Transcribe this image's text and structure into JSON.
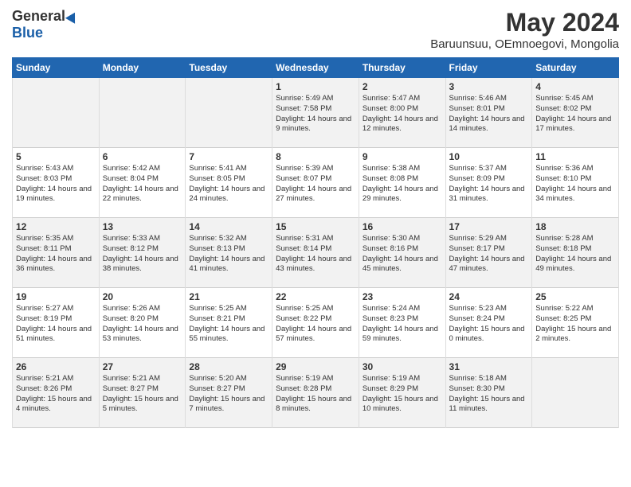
{
  "logo": {
    "general": "General",
    "blue": "Blue"
  },
  "title": "May 2024",
  "location": "Baruunsuu, OEmnoegovi, Mongolia",
  "days_of_week": [
    "Sunday",
    "Monday",
    "Tuesday",
    "Wednesday",
    "Thursday",
    "Friday",
    "Saturday"
  ],
  "weeks": [
    [
      {
        "day": "",
        "content": ""
      },
      {
        "day": "",
        "content": ""
      },
      {
        "day": "",
        "content": ""
      },
      {
        "day": "1",
        "content": "Sunrise: 5:49 AM\nSunset: 7:58 PM\nDaylight: 14 hours\nand 9 minutes."
      },
      {
        "day": "2",
        "content": "Sunrise: 5:47 AM\nSunset: 8:00 PM\nDaylight: 14 hours\nand 12 minutes."
      },
      {
        "day": "3",
        "content": "Sunrise: 5:46 AM\nSunset: 8:01 PM\nDaylight: 14 hours\nand 14 minutes."
      },
      {
        "day": "4",
        "content": "Sunrise: 5:45 AM\nSunset: 8:02 PM\nDaylight: 14 hours\nand 17 minutes."
      }
    ],
    [
      {
        "day": "5",
        "content": "Sunrise: 5:43 AM\nSunset: 8:03 PM\nDaylight: 14 hours\nand 19 minutes."
      },
      {
        "day": "6",
        "content": "Sunrise: 5:42 AM\nSunset: 8:04 PM\nDaylight: 14 hours\nand 22 minutes."
      },
      {
        "day": "7",
        "content": "Sunrise: 5:41 AM\nSunset: 8:05 PM\nDaylight: 14 hours\nand 24 minutes."
      },
      {
        "day": "8",
        "content": "Sunrise: 5:39 AM\nSunset: 8:07 PM\nDaylight: 14 hours\nand 27 minutes."
      },
      {
        "day": "9",
        "content": "Sunrise: 5:38 AM\nSunset: 8:08 PM\nDaylight: 14 hours\nand 29 minutes."
      },
      {
        "day": "10",
        "content": "Sunrise: 5:37 AM\nSunset: 8:09 PM\nDaylight: 14 hours\nand 31 minutes."
      },
      {
        "day": "11",
        "content": "Sunrise: 5:36 AM\nSunset: 8:10 PM\nDaylight: 14 hours\nand 34 minutes."
      }
    ],
    [
      {
        "day": "12",
        "content": "Sunrise: 5:35 AM\nSunset: 8:11 PM\nDaylight: 14 hours\nand 36 minutes."
      },
      {
        "day": "13",
        "content": "Sunrise: 5:33 AM\nSunset: 8:12 PM\nDaylight: 14 hours\nand 38 minutes."
      },
      {
        "day": "14",
        "content": "Sunrise: 5:32 AM\nSunset: 8:13 PM\nDaylight: 14 hours\nand 41 minutes."
      },
      {
        "day": "15",
        "content": "Sunrise: 5:31 AM\nSunset: 8:14 PM\nDaylight: 14 hours\nand 43 minutes."
      },
      {
        "day": "16",
        "content": "Sunrise: 5:30 AM\nSunset: 8:16 PM\nDaylight: 14 hours\nand 45 minutes."
      },
      {
        "day": "17",
        "content": "Sunrise: 5:29 AM\nSunset: 8:17 PM\nDaylight: 14 hours\nand 47 minutes."
      },
      {
        "day": "18",
        "content": "Sunrise: 5:28 AM\nSunset: 8:18 PM\nDaylight: 14 hours\nand 49 minutes."
      }
    ],
    [
      {
        "day": "19",
        "content": "Sunrise: 5:27 AM\nSunset: 8:19 PM\nDaylight: 14 hours\nand 51 minutes."
      },
      {
        "day": "20",
        "content": "Sunrise: 5:26 AM\nSunset: 8:20 PM\nDaylight: 14 hours\nand 53 minutes."
      },
      {
        "day": "21",
        "content": "Sunrise: 5:25 AM\nSunset: 8:21 PM\nDaylight: 14 hours\nand 55 minutes."
      },
      {
        "day": "22",
        "content": "Sunrise: 5:25 AM\nSunset: 8:22 PM\nDaylight: 14 hours\nand 57 minutes."
      },
      {
        "day": "23",
        "content": "Sunrise: 5:24 AM\nSunset: 8:23 PM\nDaylight: 14 hours\nand 59 minutes."
      },
      {
        "day": "24",
        "content": "Sunrise: 5:23 AM\nSunset: 8:24 PM\nDaylight: 15 hours\nand 0 minutes."
      },
      {
        "day": "25",
        "content": "Sunrise: 5:22 AM\nSunset: 8:25 PM\nDaylight: 15 hours\nand 2 minutes."
      }
    ],
    [
      {
        "day": "26",
        "content": "Sunrise: 5:21 AM\nSunset: 8:26 PM\nDaylight: 15 hours\nand 4 minutes."
      },
      {
        "day": "27",
        "content": "Sunrise: 5:21 AM\nSunset: 8:27 PM\nDaylight: 15 hours\nand 5 minutes."
      },
      {
        "day": "28",
        "content": "Sunrise: 5:20 AM\nSunset: 8:27 PM\nDaylight: 15 hours\nand 7 minutes."
      },
      {
        "day": "29",
        "content": "Sunrise: 5:19 AM\nSunset: 8:28 PM\nDaylight: 15 hours\nand 8 minutes."
      },
      {
        "day": "30",
        "content": "Sunrise: 5:19 AM\nSunset: 8:29 PM\nDaylight: 15 hours\nand 10 minutes."
      },
      {
        "day": "31",
        "content": "Sunrise: 5:18 AM\nSunset: 8:30 PM\nDaylight: 15 hours\nand 11 minutes."
      },
      {
        "day": "",
        "content": ""
      }
    ]
  ]
}
